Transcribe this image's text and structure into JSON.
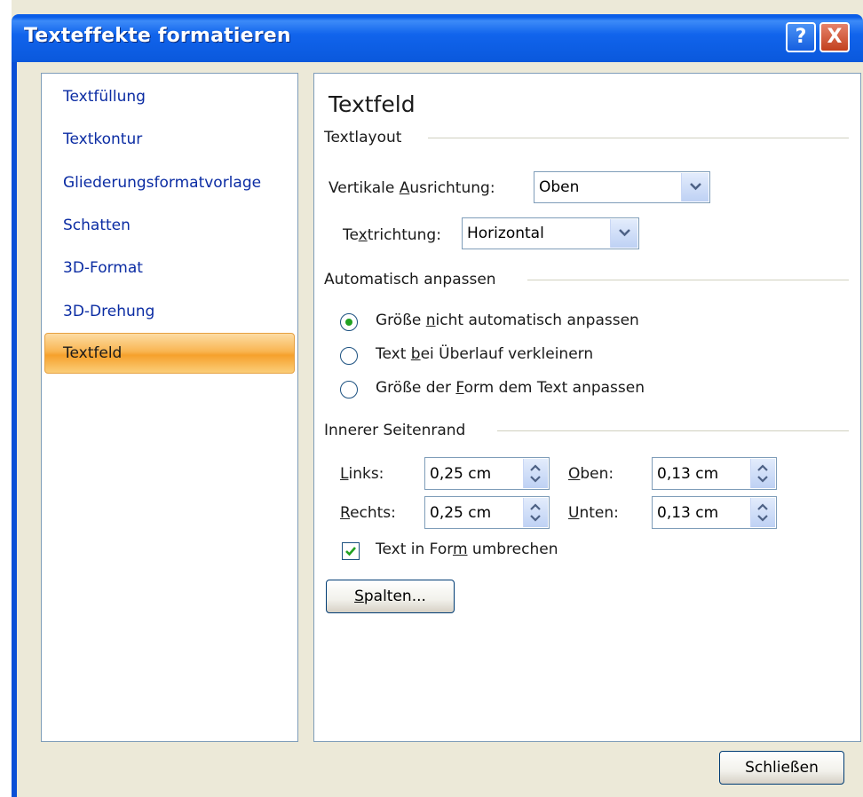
{
  "window": {
    "title": "Texteffekte formatieren",
    "help_label": "?",
    "close_label": "X"
  },
  "nav": {
    "items": [
      {
        "label": "Textfüllung"
      },
      {
        "label": "Textkontur"
      },
      {
        "label": "Gliederungsformatvorlage"
      },
      {
        "label": "Schatten"
      },
      {
        "label": "3D-Format"
      },
      {
        "label": "3D-Drehung"
      },
      {
        "label": "Textfeld"
      }
    ],
    "selected_index": 6
  },
  "textfeld": {
    "heading": "Textfeld",
    "textlayout": {
      "group_title": "Textlayout",
      "vertical_alignment": {
        "label_pre": "Vertikale ",
        "label_u": "A",
        "label_post": "usrichtung:",
        "value": "Oben"
      },
      "text_direction": {
        "label_pre": "Te",
        "label_u": "x",
        "label_post": "trichtung:",
        "value": "Horizontal"
      }
    },
    "autofit": {
      "group_title": "Automatisch anpassen",
      "options": [
        {
          "pre": "Größe ",
          "u": "n",
          "post": "icht automatisch anpassen",
          "checked": true
        },
        {
          "pre": "Text ",
          "u": "b",
          "post": "ei Überlauf verkleinern",
          "checked": false
        },
        {
          "pre": "Größe der ",
          "u": "F",
          "post": "orm dem Text anpassen",
          "checked": false
        }
      ]
    },
    "margins": {
      "group_title": "Innerer Seitenrand",
      "left": {
        "label_u": "L",
        "label_post": "inks:",
        "value": "0,25 cm"
      },
      "right": {
        "label_u": "R",
        "label_post": "echts:",
        "value": "0,25 cm"
      },
      "top": {
        "label_u": "O",
        "label_post": "ben:",
        "value": "0,13 cm"
      },
      "bottom": {
        "label_u": "U",
        "label_post": "nten:",
        "value": "0,13 cm"
      }
    },
    "wrap": {
      "pre": "Text in For",
      "u": "m",
      "post": " umbrechen",
      "checked": true
    },
    "columns_button": {
      "u": "S",
      "post": "palten..."
    }
  },
  "footer": {
    "close_button": "Schließen"
  },
  "colors": {
    "titlebar": "#0A58DC",
    "dialog_bg": "#ECE9D8",
    "nav_link": "#0B2CA3",
    "selected_item": "#F6A12C",
    "radio_dot": "#21A121",
    "check_mark": "#21A121"
  }
}
